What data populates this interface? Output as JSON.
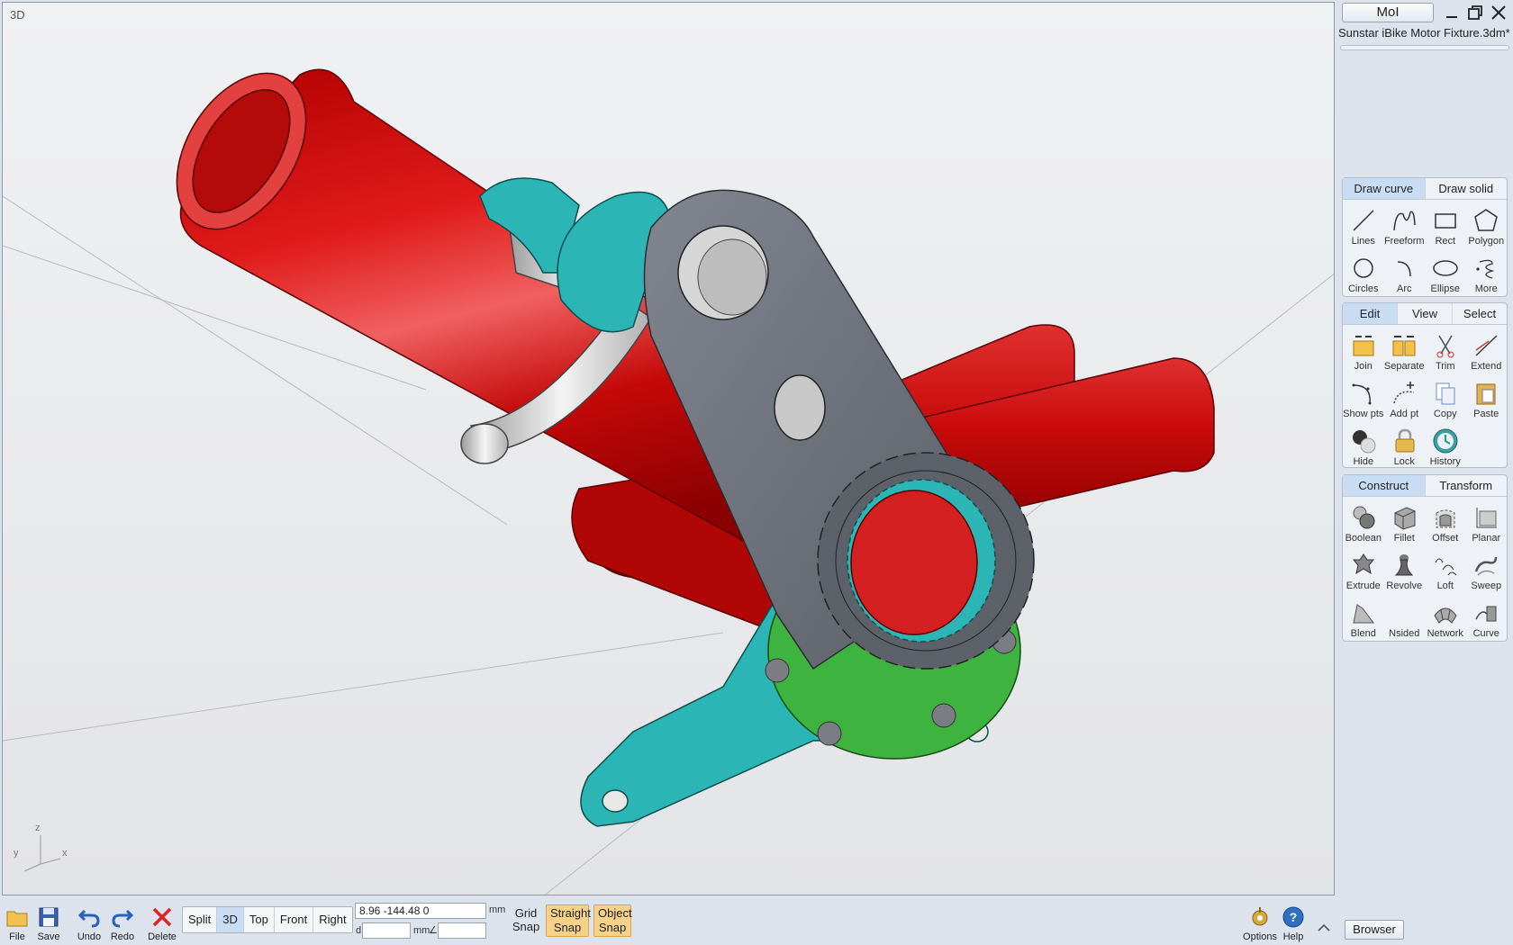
{
  "viewport": {
    "label": "3D"
  },
  "axes": {
    "z": "z",
    "y": "y",
    "x": "x"
  },
  "app": {
    "name": "MoI",
    "file": "Sunstar iBike Motor Fixture.3dm*",
    "minimize_icon": "minimize-icon",
    "restore_icon": "restore-icon",
    "close_icon": "close-icon"
  },
  "draw_palette": {
    "tabs": [
      {
        "label": "Draw curve",
        "active": true
      },
      {
        "label": "Draw solid",
        "active": false
      }
    ],
    "tools": [
      {
        "label": "Lines",
        "icon": "line-icon"
      },
      {
        "label": "Freeform",
        "icon": "freeform-icon"
      },
      {
        "label": "Rect",
        "icon": "rect-icon"
      },
      {
        "label": "Polygon",
        "icon": "polygon-icon"
      },
      {
        "label": "Circles",
        "icon": "circle-icon"
      },
      {
        "label": "Arc",
        "icon": "arc-icon"
      },
      {
        "label": "Ellipse",
        "icon": "ellipse-icon"
      },
      {
        "label": "More",
        "icon": "more-icon"
      }
    ]
  },
  "edit_palette": {
    "tabs": [
      {
        "label": "Edit",
        "active": true
      },
      {
        "label": "View",
        "active": false
      },
      {
        "label": "Select",
        "active": false
      }
    ],
    "tools": [
      {
        "label": "Join",
        "icon": "join-icon"
      },
      {
        "label": "Separate",
        "icon": "separate-icon"
      },
      {
        "label": "Trim",
        "icon": "trim-icon"
      },
      {
        "label": "Extend",
        "icon": "extend-icon"
      },
      {
        "label": "Show pts",
        "icon": "show-points-icon"
      },
      {
        "label": "Add pt",
        "icon": "add-point-icon"
      },
      {
        "label": "Copy",
        "icon": "copy-icon"
      },
      {
        "label": "Paste",
        "icon": "paste-icon"
      },
      {
        "label": "Hide",
        "icon": "hide-icon"
      },
      {
        "label": "Lock",
        "icon": "lock-icon"
      },
      {
        "label": "History",
        "icon": "history-icon"
      }
    ]
  },
  "construct_palette": {
    "tabs": [
      {
        "label": "Construct",
        "active": true
      },
      {
        "label": "Transform",
        "active": false
      }
    ],
    "tools": [
      {
        "label": "Boolean",
        "icon": "boolean-icon"
      },
      {
        "label": "Fillet",
        "icon": "fillet-icon"
      },
      {
        "label": "Offset",
        "icon": "offset-icon"
      },
      {
        "label": "Planar",
        "icon": "planar-icon"
      },
      {
        "label": "Extrude",
        "icon": "extrude-icon"
      },
      {
        "label": "Revolve",
        "icon": "revolve-icon"
      },
      {
        "label": "Loft",
        "icon": "loft-icon"
      },
      {
        "label": "Sweep",
        "icon": "sweep-icon"
      },
      {
        "label": "Blend",
        "icon": "blend-icon"
      },
      {
        "label": "Nsided",
        "icon": "nsided-icon"
      },
      {
        "label": "Network",
        "icon": "network-icon"
      },
      {
        "label": "Curve",
        "icon": "curve-icon"
      }
    ]
  },
  "toolbar": {
    "file": "File",
    "save": "Save",
    "undo": "Undo",
    "redo": "Redo",
    "delete": "Delete",
    "views": [
      {
        "label": "Split",
        "active": false
      },
      {
        "label": "3D",
        "active": true
      },
      {
        "label": "Top",
        "active": false
      },
      {
        "label": "Front",
        "active": false
      },
      {
        "label": "Right",
        "active": false
      }
    ],
    "coords": "8.96   -144.48   0",
    "unit": "mm",
    "distance_label": "d",
    "distance_unit": "mm",
    "angle_label": "∠",
    "grid_snap": "Grid Snap",
    "straight_snap": "Straight Snap",
    "object_snap": "Object Snap",
    "options": "Options",
    "help": "Help",
    "browser": "Browser"
  },
  "colors": {
    "tube_red": "#d10c0c",
    "bracket_teal": "#2bb5b5",
    "plate_gray": "#6e727a",
    "ring_green": "#3fb33f",
    "accent_tab": "#c8ddf3",
    "snap_active": "#f6d189"
  }
}
